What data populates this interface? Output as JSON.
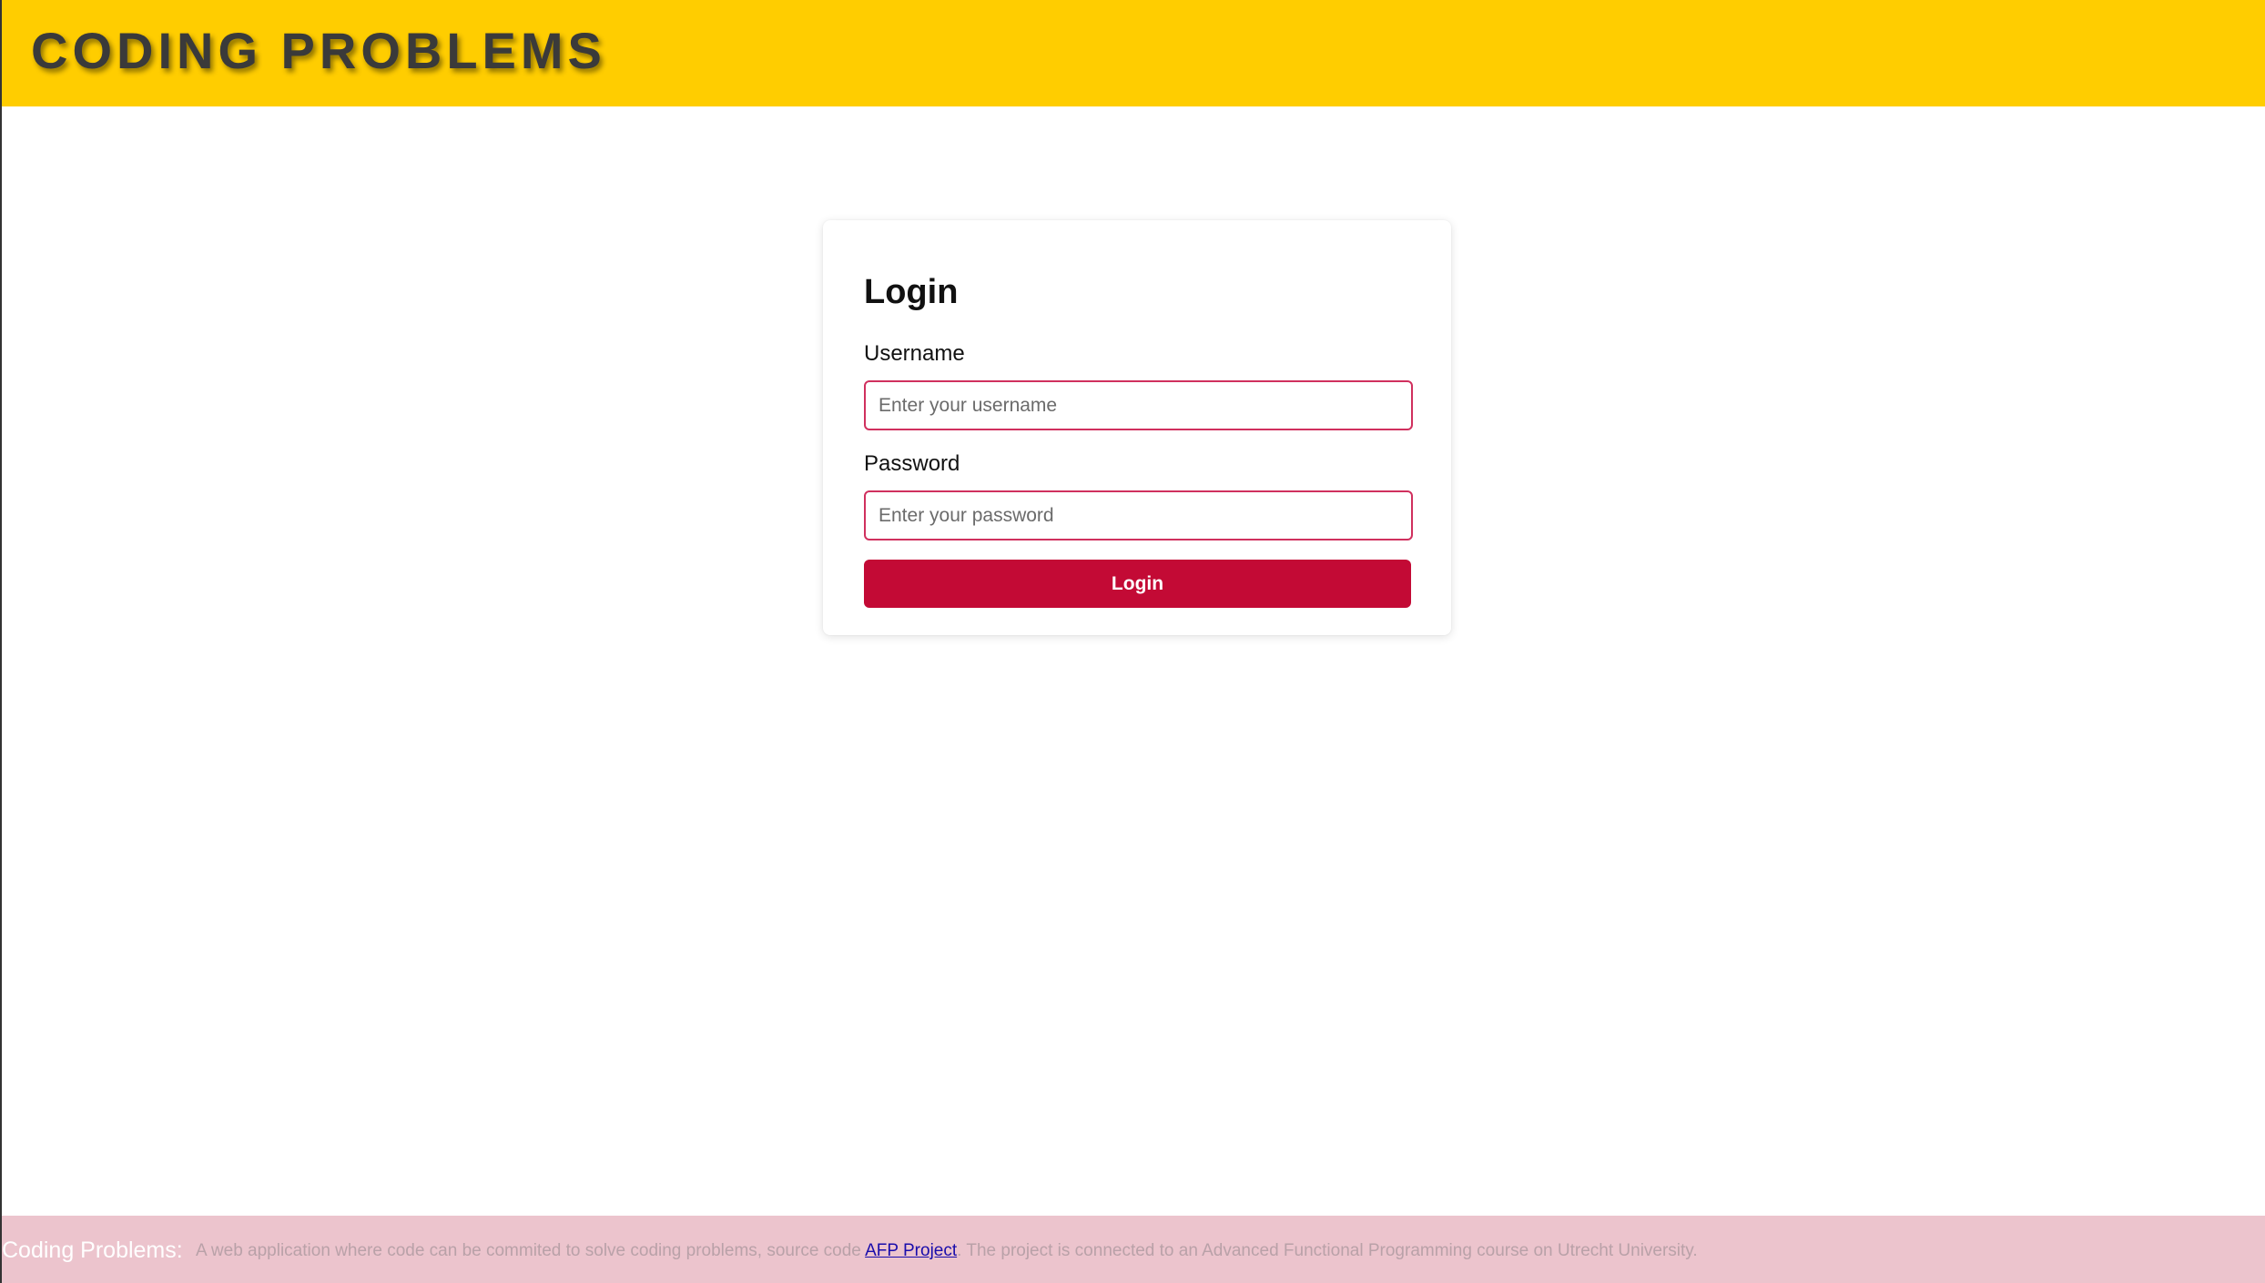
{
  "header": {
    "brand": "CODING PROBLEMS"
  },
  "login_form": {
    "title": "Login",
    "username_label": "Username",
    "username_placeholder": "Enter your username",
    "username_value": "",
    "password_label": "Password",
    "password_placeholder": "Enter your password",
    "password_value": "",
    "submit_label": "Login"
  },
  "footer": {
    "title": "Coding Problems:",
    "description_prefix": "A web application where code can be commited to solve coding problems, source code",
    "link_text": "AFP Project",
    "description_suffix": ". The project is connected to an Advanced Functional Programming course on Utrecht University."
  },
  "colors": {
    "header_background": "#ffcd00",
    "brand_text": "#3a3a3a",
    "input_border": "#d0305e",
    "button_background": "#c30a35",
    "footer_background": "#ecc4cd",
    "link": "#1a0dab"
  }
}
